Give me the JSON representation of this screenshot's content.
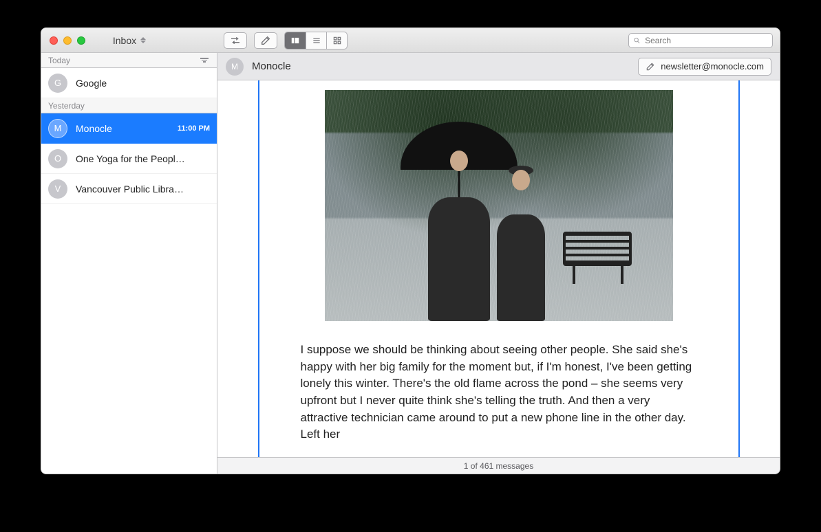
{
  "window": {
    "title": "Inbox"
  },
  "toolbar": {
    "search_placeholder": "Search"
  },
  "sidebar": {
    "sections": [
      {
        "label": "Today",
        "items": [
          {
            "initial": "G",
            "sender": "Google",
            "time": "",
            "selected": false
          }
        ]
      },
      {
        "label": "Yesterday",
        "items": [
          {
            "initial": "M",
            "sender": "Monocle",
            "time": "11:00 PM",
            "selected": true
          },
          {
            "initial": "O",
            "sender": "One Yoga for the People | V…",
            "time": "",
            "selected": false
          },
          {
            "initial": "V",
            "sender": "Vancouver Public Library N…",
            "time": "",
            "selected": false
          }
        ]
      }
    ]
  },
  "message": {
    "sender_initial": "M",
    "sender": "Monocle",
    "address": "newsletter@monocle.com",
    "body": "I suppose we should be thinking about seeing other people. She said she's happy with her big family for the moment but, if I'm honest, I've been getting lonely this winter. There's the old flame across the pond – she seems very upfront but I never quite think she's telling the truth. And then a very attractive technician came around to put a new phone line in the other day. Left her"
  },
  "status": "1 of 461 messages"
}
